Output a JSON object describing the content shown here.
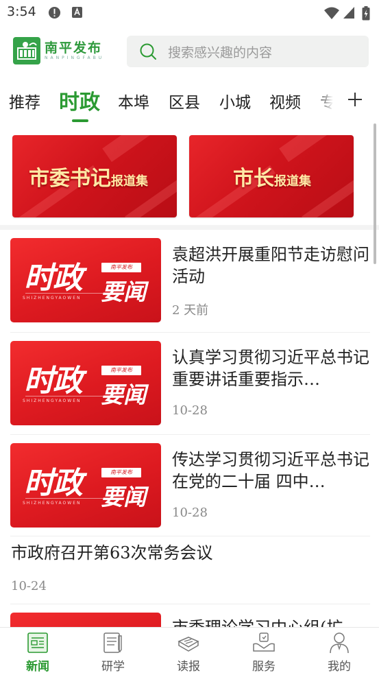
{
  "status_bar": {
    "time": "3:54"
  },
  "header": {
    "logo_cn": "南平发布",
    "logo_en": "NANPINGFABU",
    "search_placeholder": "搜索感兴趣的内容"
  },
  "tabs": [
    {
      "label": "推荐",
      "active": false
    },
    {
      "label": "时政",
      "active": true
    },
    {
      "label": "本埠",
      "active": false
    },
    {
      "label": "区县",
      "active": false
    },
    {
      "label": "小城",
      "active": false
    },
    {
      "label": "视频",
      "active": false
    },
    {
      "label": "专",
      "active": false
    }
  ],
  "banners": [
    {
      "main": "市委书记",
      "sub": "报道集"
    },
    {
      "main": "市长",
      "sub": "报道集"
    }
  ],
  "thumbnail": {
    "big": "时政",
    "small": "要闻",
    "badge": "南平发布",
    "en": "SHIZHENGYAOWEN"
  },
  "news": [
    {
      "title": "袁超洪开展重阳节走访慰问活动",
      "date": "2 天前"
    },
    {
      "title": "认真学习贯彻习近平总书记 重要讲话重要指示…",
      "date": "10-28"
    },
    {
      "title": "传达学习贯彻习近平总书记在党的二十届 四中…",
      "date": "10-28"
    },
    {
      "title": "市政府召开第63次常务会议",
      "date": "10-24"
    },
    {
      "title": "市委理论学习中心组(扩",
      "date": ""
    }
  ],
  "bottom_nav": [
    {
      "label": "新闻",
      "icon": "newspaper-icon",
      "active": true
    },
    {
      "label": "研学",
      "icon": "notebook-icon",
      "active": false
    },
    {
      "label": "读报",
      "icon": "read-paper-icon",
      "active": false
    },
    {
      "label": "服务",
      "icon": "service-icon",
      "active": false
    },
    {
      "label": "我的",
      "icon": "profile-icon",
      "active": false
    }
  ],
  "colors": {
    "accent_green": "#2b9a32",
    "banner_red": "#d0141c",
    "banner_text": "#ffe9a6"
  }
}
